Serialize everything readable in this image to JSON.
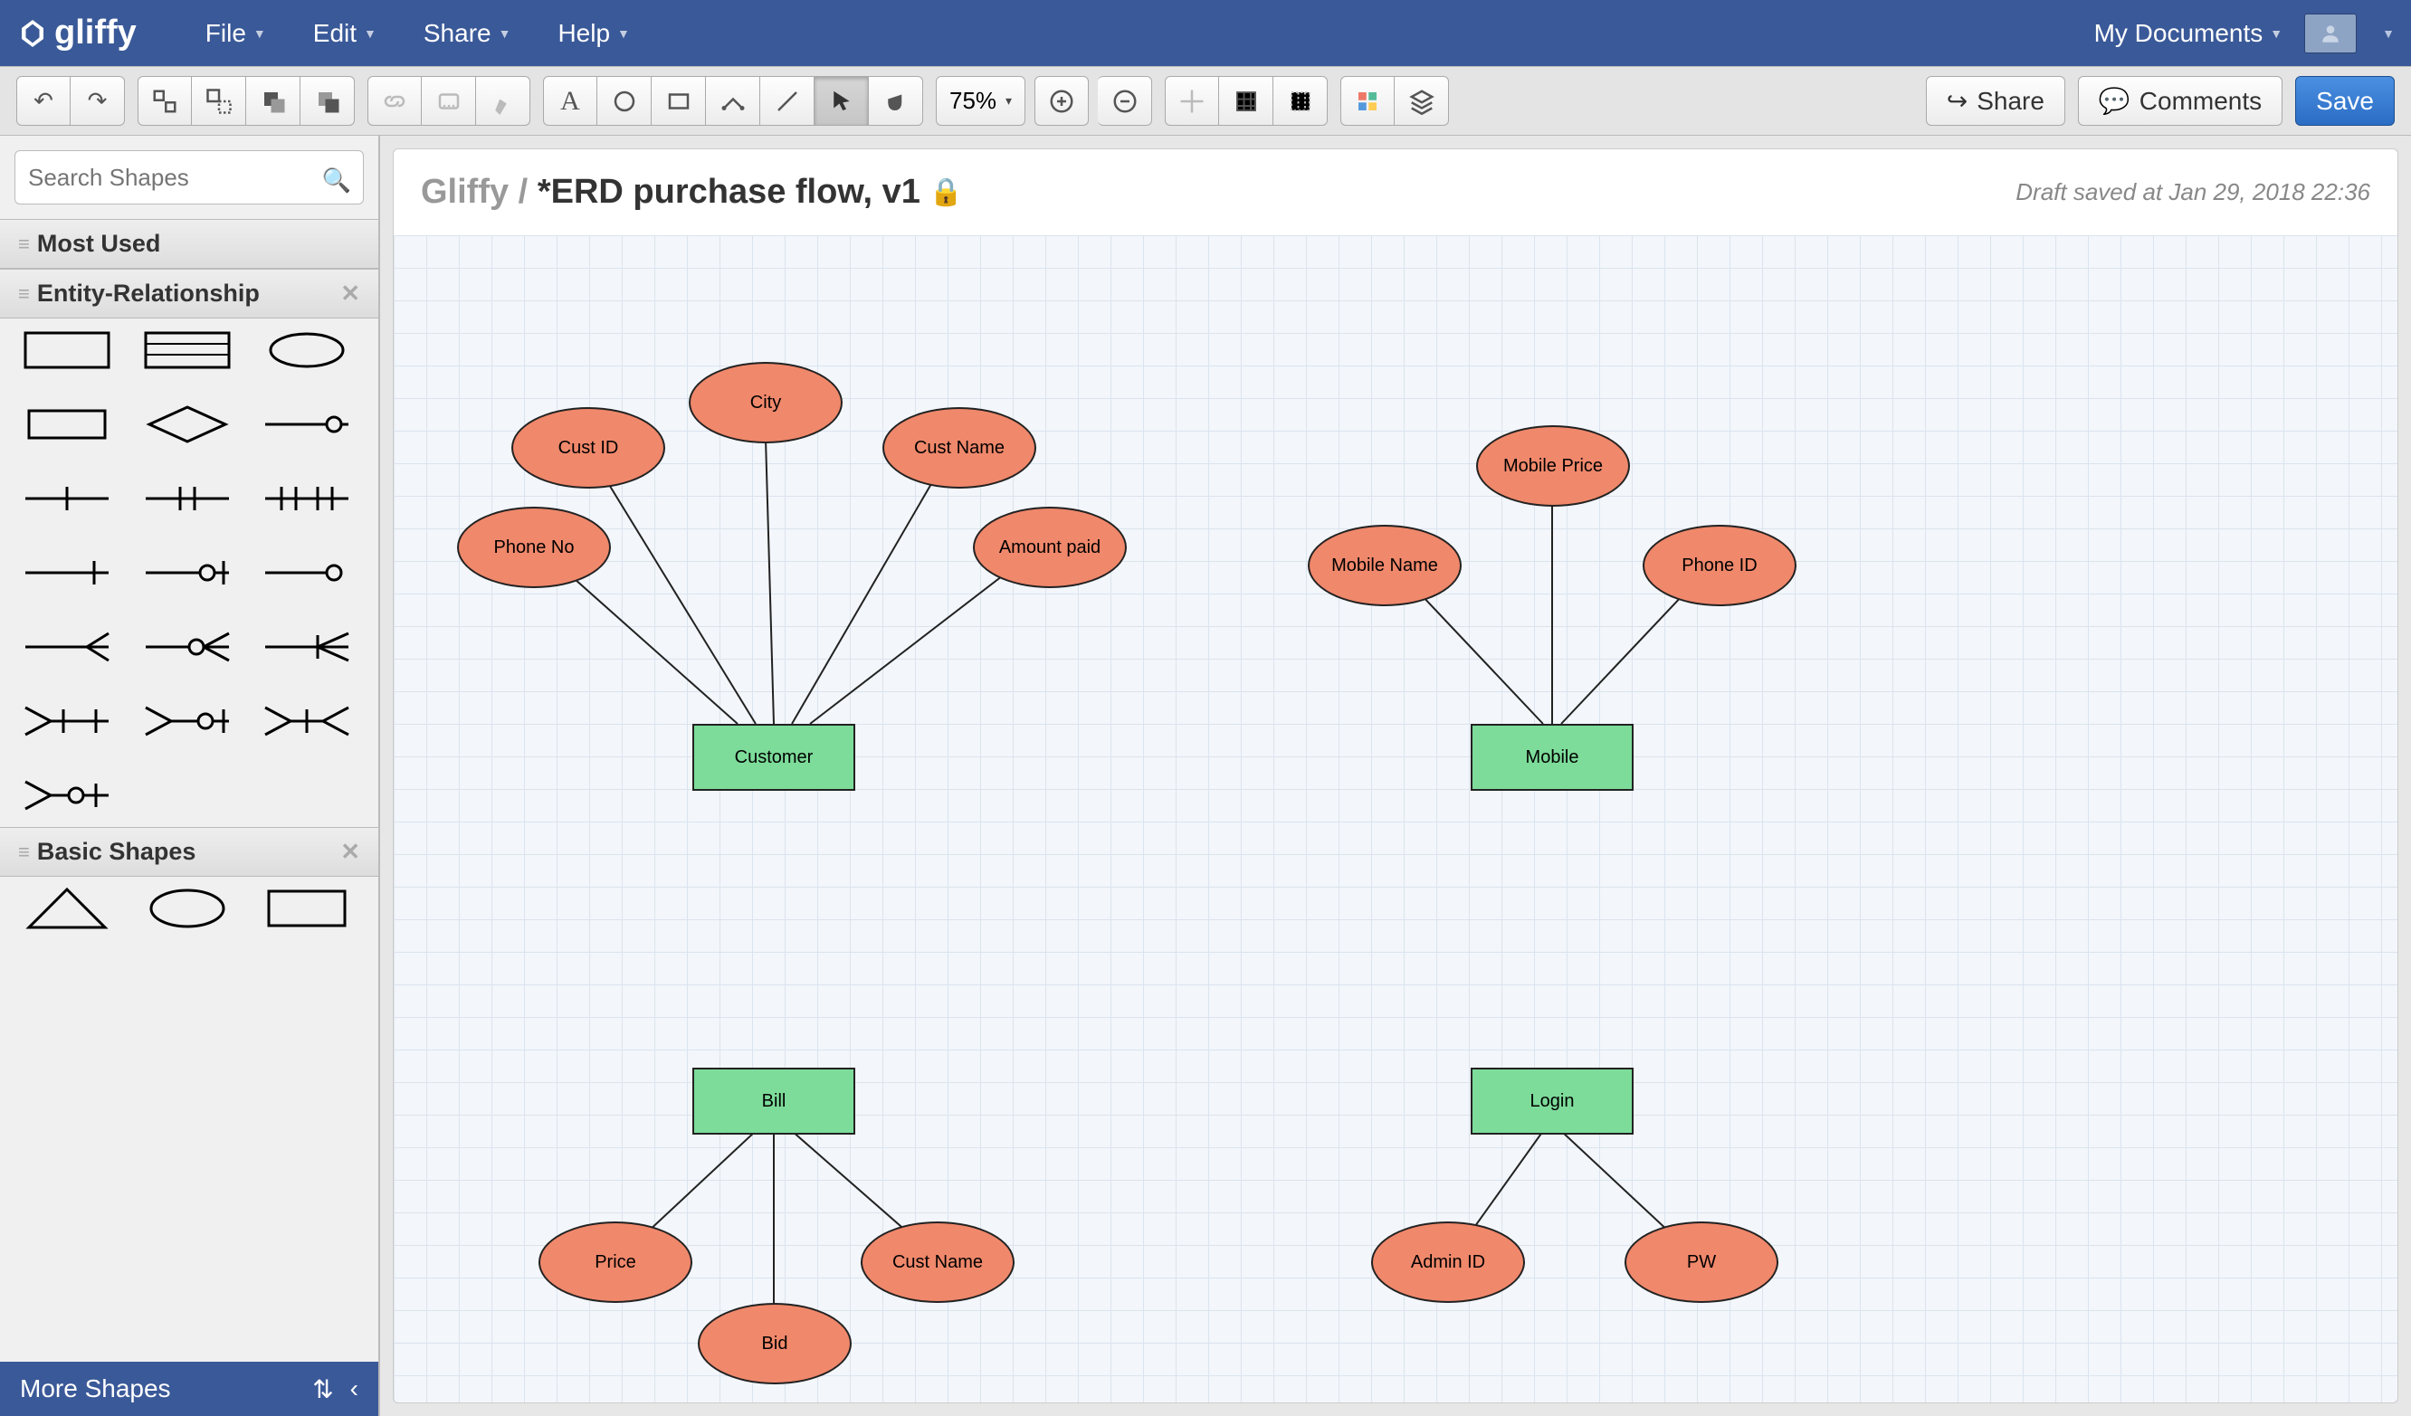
{
  "menubar": {
    "logo_text": "gliffy",
    "menus": [
      "File",
      "Edit",
      "Share",
      "Help"
    ],
    "my_docs": "My Documents"
  },
  "toolbar": {
    "zoom": "75%",
    "share": "Share",
    "comments": "Comments",
    "save": "Save"
  },
  "sidebar": {
    "search_placeholder": "Search Shapes",
    "panels": {
      "most_used": "Most Used",
      "er": "Entity-Relationship",
      "basic": "Basic Shapes"
    },
    "footer": "More Shapes"
  },
  "doc": {
    "breadcrumb": "Gliffy",
    "title": "*ERD purchase flow, v1",
    "draft": "Draft saved at Jan 29, 2018 22:36"
  },
  "diagram": {
    "entities": {
      "customer": "Customer",
      "mobile": "Mobile",
      "bill": "Bill",
      "login": "Login"
    },
    "attrs": {
      "phone_no": "Phone No",
      "cust_id": "Cust ID",
      "city": "City",
      "cust_name1": "Cust Name",
      "amount_paid": "Amount paid",
      "mobile_name": "Mobile Name",
      "mobile_price": "Mobile Price",
      "phone_id": "Phone ID",
      "price": "Price",
      "bid": "Bid",
      "cust_name2": "Cust Name",
      "admin_id": "Admin ID",
      "pw": "PW"
    }
  }
}
